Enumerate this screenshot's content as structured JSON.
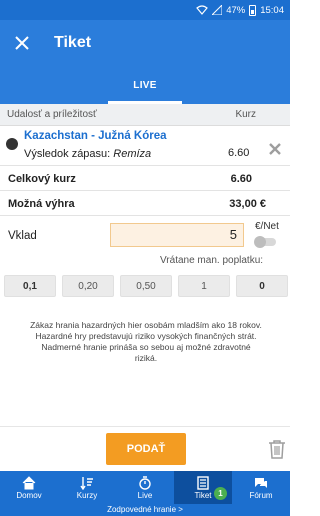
{
  "status_bar": {
    "battery": "47%",
    "time": "15:04"
  },
  "app_bar": {
    "title": "Tiket"
  },
  "tabs": [
    {
      "label": "LIVE",
      "active": true
    }
  ],
  "table_header": {
    "event_label": "Udalosť a príležitosť",
    "odds_label": "Kurz"
  },
  "bet": {
    "match": "Kazachstan - Južná Kórea",
    "market_label": "Výsledok zápasu:",
    "selection": "Remíza",
    "odds": "6.60"
  },
  "summary": {
    "total_odds_label": "Celkový kurz",
    "total_odds_value": "6.60",
    "possible_win_label": "Možná výhra",
    "possible_win_value": "33,00 €"
  },
  "stake": {
    "label": "Vklad",
    "value": "5",
    "currency_toggle_label": "€/Net",
    "toggle_on": false,
    "fee_label": "Vrátane man. poplatku:"
  },
  "quick_amounts": [
    "0,1",
    "0,20",
    "0,50",
    "1",
    "0"
  ],
  "warning": {
    "line1": "Zákaz hrania hazardných hier osobám mladším ako 18 rokov.",
    "line2": "Hazardné hry predstavujú riziko vysokých finančných strát.",
    "line3": "Nadmerné hranie prináša so sebou aj možné zdravotné riziká."
  },
  "actions": {
    "submit_label": "PODAŤ"
  },
  "bottom_nav": [
    {
      "label": "Domov",
      "icon": "home-icon"
    },
    {
      "label": "Kurzy",
      "icon": "sort-icon"
    },
    {
      "label": "Live",
      "icon": "stopwatch-icon"
    },
    {
      "label": "Tiket",
      "icon": "ticket-icon",
      "active": true,
      "badge": "1"
    },
    {
      "label": "Fórum",
      "icon": "chat-icon"
    }
  ],
  "footer": {
    "link_label": "Zodpovedné hranie >"
  },
  "colors": {
    "primary": "#2b7ddb",
    "primary_dark": "#1c6fcf",
    "accent": "#f39c22",
    "badge": "#4caf50"
  }
}
